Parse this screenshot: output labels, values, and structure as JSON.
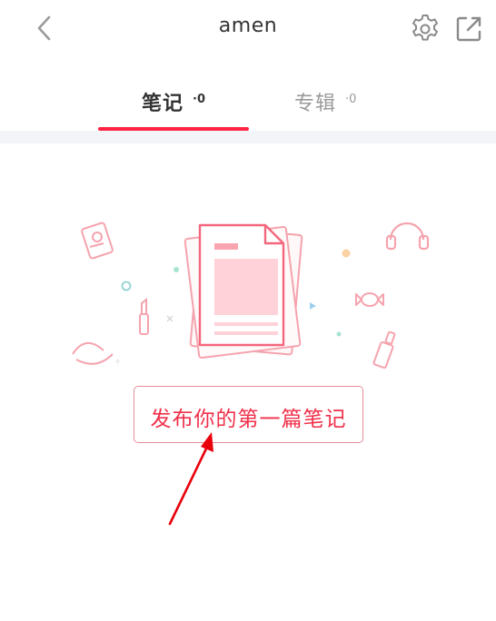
{
  "header": {
    "title": "amen",
    "back_icon": "chevron-left-icon",
    "settings_icon": "gear-icon",
    "share_icon": "external-link-icon"
  },
  "tabs": [
    {
      "label": "笔记",
      "count": "·0",
      "active": true
    },
    {
      "label": "专辑",
      "count": "·0",
      "active": false
    }
  ],
  "empty_state": {
    "illustration": "empty-notes-illustration",
    "publish_button": "发布你的第一篇笔记"
  },
  "colors": {
    "accent": "#ff2442",
    "annotation_arrow": "#e8000b",
    "illustration_pink": "#f5a3ae"
  }
}
